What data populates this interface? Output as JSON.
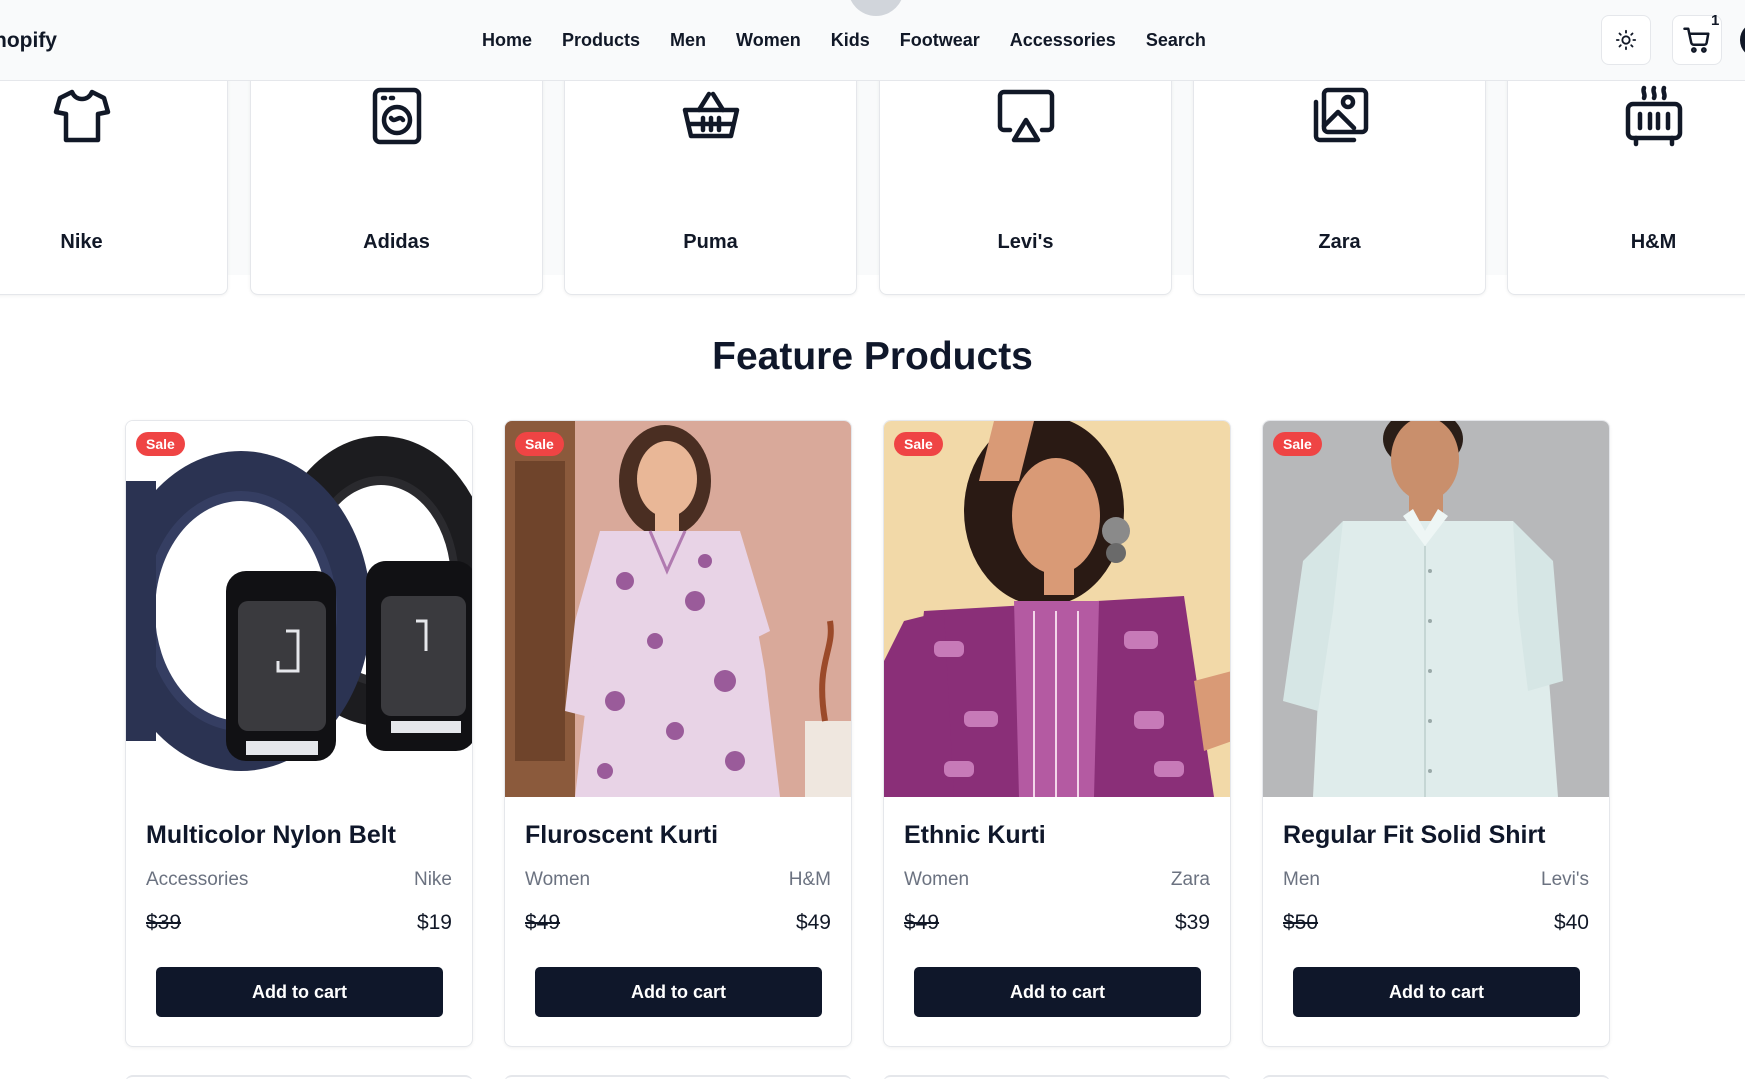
{
  "header": {
    "logo": "hopify",
    "nav": [
      "Home",
      "Products",
      "Men",
      "Women",
      "Kids",
      "Footwear",
      "Accessories",
      "Search"
    ],
    "cart_count": "1"
  },
  "brands": [
    {
      "name": "Nike",
      "icon": "tshirt-icon"
    },
    {
      "name": "Adidas",
      "icon": "washing-machine-icon"
    },
    {
      "name": "Puma",
      "icon": "basket-icon"
    },
    {
      "name": "Levi's",
      "icon": "airplay-icon"
    },
    {
      "name": "Zara",
      "icon": "photos-icon"
    },
    {
      "name": "H&M",
      "icon": "heater-icon"
    }
  ],
  "section_title": "Feature Products",
  "products": [
    {
      "badge": "Sale",
      "name": "Multicolor Nylon Belt",
      "category": "Accessories",
      "brand": "Nike",
      "old_price": "$39",
      "price": "$19",
      "button": "Add to cart"
    },
    {
      "badge": "Sale",
      "name": "Fluroscent Kurti",
      "category": "Women",
      "brand": "H&M",
      "old_price": "$49",
      "price": "$49",
      "button": "Add to cart"
    },
    {
      "badge": "Sale",
      "name": "Ethnic Kurti",
      "category": "Women",
      "brand": "Zara",
      "old_price": "$49",
      "price": "$39",
      "button": "Add to cart"
    },
    {
      "badge": "Sale",
      "name": "Regular Fit Solid Shirt",
      "category": "Men",
      "brand": "Levi's",
      "old_price": "$50",
      "price": "$40",
      "button": "Add to cart"
    }
  ],
  "colors": {
    "sale_badge": "#ef4444",
    "button_bg": "#0f172a",
    "header_bg": "#f9fafb"
  }
}
